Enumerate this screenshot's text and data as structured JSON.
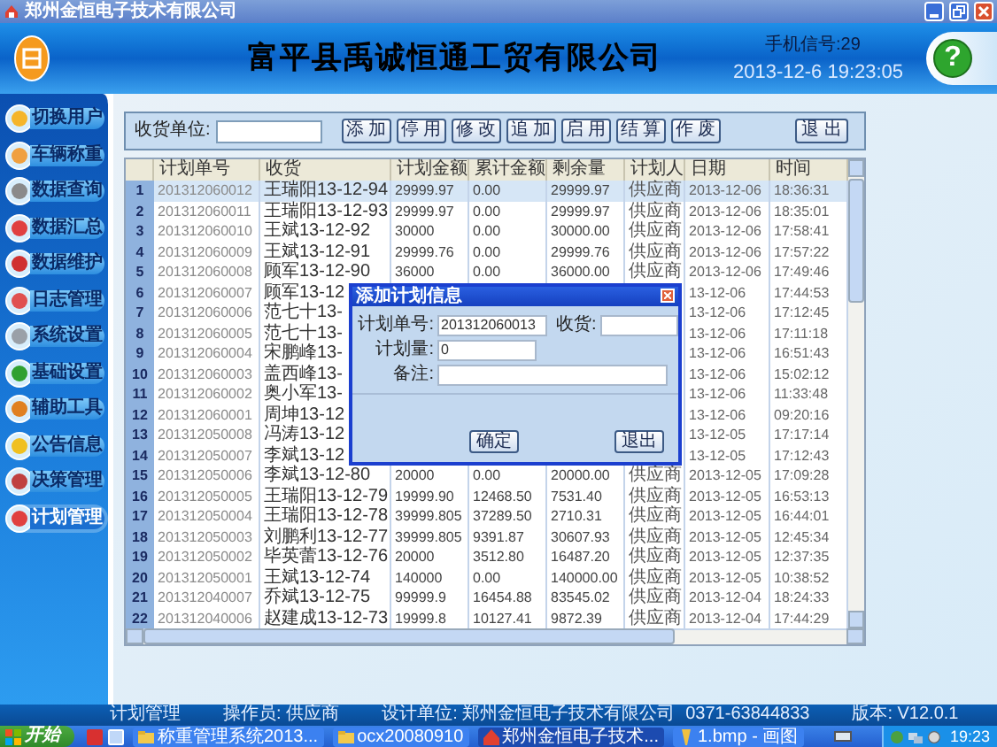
{
  "window": {
    "title": "郑州金恒电子技术有限公司"
  },
  "header": {
    "company": "富平县禹诚恒通工贸有限公司",
    "signal": "手机信号:29",
    "datetime": "2013-12-6 19:23:05",
    "help": "?"
  },
  "sidebar": {
    "items": [
      {
        "label": "切换用户",
        "selected": false
      },
      {
        "label": "车辆称重",
        "selected": false
      },
      {
        "label": "数据查询",
        "selected": false
      },
      {
        "label": "数据汇总",
        "selected": false
      },
      {
        "label": "数据维护",
        "selected": false
      },
      {
        "label": "日志管理",
        "selected": false
      },
      {
        "label": "系统设置",
        "selected": false
      },
      {
        "label": "基础设置",
        "selected": false
      },
      {
        "label": "辅助工具",
        "selected": false
      },
      {
        "label": "公告信息",
        "selected": false
      },
      {
        "label": "决策管理",
        "selected": false
      },
      {
        "label": "计划管理",
        "selected": true
      }
    ]
  },
  "toolbar": {
    "field_label": "收货单位:",
    "buttons": [
      "添 加",
      "停 用",
      "修 改",
      "追 加",
      "启 用",
      "结 算",
      "作 废"
    ],
    "exit": "退 出"
  },
  "table": {
    "columns": [
      "计划单号",
      "收货",
      "计划金额",
      "累计金额",
      "剩余量",
      "计划人",
      "日期",
      "时间"
    ],
    "rows": [
      {
        "no": "1",
        "selected": true,
        "cells": [
          "201312060012",
          "王瑞阳13-12-94",
          "29999.97",
          "0.00",
          "29999.97",
          "供应商",
          "2013-12-06",
          "18:36:31"
        ]
      },
      {
        "no": "2",
        "selected": false,
        "cells": [
          "201312060011",
          "王瑞阳13-12-93",
          "29999.97",
          "0.00",
          "29999.97",
          "供应商",
          "2013-12-06",
          "18:35:01"
        ]
      },
      {
        "no": "3",
        "selected": false,
        "cells": [
          "201312060010",
          "王斌13-12-92",
          "30000",
          "0.00",
          "30000.00",
          "供应商",
          "2013-12-06",
          "17:58:41"
        ]
      },
      {
        "no": "4",
        "selected": false,
        "cells": [
          "201312060009",
          "王斌13-12-91",
          "29999.76",
          "0.00",
          "29999.76",
          "供应商",
          "2013-12-06",
          "17:57:22"
        ]
      },
      {
        "no": "5",
        "selected": false,
        "cells": [
          "201312060008",
          "顾军13-12-90",
          "36000",
          "0.00",
          "36000.00",
          "供应商",
          "2013-12-06",
          "17:49:46"
        ]
      },
      {
        "no": "6",
        "selected": false,
        "cells": [
          "201312060007",
          "顾军13-12",
          null,
          null,
          null,
          null,
          "13-12-06",
          "17:44:53"
        ]
      },
      {
        "no": "7",
        "selected": false,
        "cells": [
          "201312060006",
          "范七十13-",
          null,
          null,
          null,
          null,
          "13-12-06",
          "17:12:45"
        ]
      },
      {
        "no": "8",
        "selected": false,
        "cells": [
          "201312060005",
          "范七十13-",
          null,
          null,
          null,
          null,
          "13-12-06",
          "17:11:18"
        ]
      },
      {
        "no": "9",
        "selected": false,
        "cells": [
          "201312060004",
          "宋鹏峰13-",
          null,
          null,
          null,
          null,
          "13-12-06",
          "16:51:43"
        ]
      },
      {
        "no": "10",
        "selected": false,
        "cells": [
          "201312060003",
          "盖西峰13-",
          null,
          null,
          null,
          null,
          "13-12-06",
          "15:02:12"
        ]
      },
      {
        "no": "11",
        "selected": false,
        "cells": [
          "201312060002",
          "奥小军13-",
          null,
          null,
          null,
          null,
          "13-12-06",
          "11:33:48"
        ]
      },
      {
        "no": "12",
        "selected": false,
        "cells": [
          "201312060001",
          "周坤13-12",
          null,
          null,
          null,
          null,
          "13-12-06",
          "09:20:16"
        ]
      },
      {
        "no": "13",
        "selected": false,
        "cells": [
          "201312050008",
          "冯涛13-12",
          null,
          null,
          null,
          null,
          "13-12-05",
          "17:17:14"
        ]
      },
      {
        "no": "14",
        "selected": false,
        "cells": [
          "201312050007",
          "李斌13-12",
          null,
          null,
          null,
          null,
          "13-12-05",
          "17:12:43"
        ]
      },
      {
        "no": "15",
        "selected": false,
        "cells": [
          "201312050006",
          "李斌13-12-80",
          "20000",
          "0.00",
          "20000.00",
          "供应商",
          "2013-12-05",
          "17:09:28"
        ]
      },
      {
        "no": "16",
        "selected": false,
        "cells": [
          "201312050005",
          "王瑞阳13-12-79",
          "19999.90",
          "12468.50",
          "7531.40",
          "供应商",
          "2013-12-05",
          "16:53:13"
        ]
      },
      {
        "no": "17",
        "selected": false,
        "cells": [
          "201312050004",
          "王瑞阳13-12-78",
          "39999.805",
          "37289.50",
          "2710.31",
          "供应商",
          "2013-12-05",
          "16:44:01"
        ]
      },
      {
        "no": "18",
        "selected": false,
        "cells": [
          "201312050003",
          "刘鹏利13-12-77",
          "39999.805",
          "9391.87",
          "30607.93",
          "供应商",
          "2013-12-05",
          "12:45:34"
        ]
      },
      {
        "no": "19",
        "selected": false,
        "cells": [
          "201312050002",
          "毕英蕾13-12-76",
          "20000",
          "3512.80",
          "16487.20",
          "供应商",
          "2013-12-05",
          "12:37:35"
        ]
      },
      {
        "no": "20",
        "selected": false,
        "cells": [
          "201312050001",
          "王斌13-12-74",
          "140000",
          "0.00",
          "140000.00",
          "供应商",
          "2013-12-05",
          "10:38:52"
        ]
      },
      {
        "no": "21",
        "selected": false,
        "cells": [
          "201312040007",
          "乔斌13-12-75",
          "99999.9",
          "16454.88",
          "83545.02",
          "供应商",
          "2013-12-04",
          "18:24:33"
        ]
      },
      {
        "no": "22",
        "selected": false,
        "cells": [
          "201312040006",
          "赵建成13-12-73",
          "19999.8",
          "10127.41",
          "9872.39",
          "供应商",
          "2013-12-04",
          "17:44:29"
        ]
      }
    ]
  },
  "dialog": {
    "title": "添加计划信息",
    "fields": [
      {
        "label": "计划单号:",
        "value": "201312060013"
      },
      {
        "label": "收货:"
      },
      {
        "label": "计划量:",
        "value": "0"
      },
      {
        "label": "备注:"
      }
    ],
    "buttons": [
      "确定",
      "退出"
    ]
  },
  "status_bar": [
    "计划管理",
    "操作员: 供应商",
    "设计单位: 郑州金恒电子技术有限公司",
    "0371-63844833",
    "版本: V12.0.1"
  ],
  "taskbar": {
    "start": "开始",
    "tasks": [
      {
        "label": "称重管理系统2013...",
        "selected": false
      },
      {
        "label": "ocx20080910",
        "selected": false
      },
      {
        "label": "郑州金恒电子技术...",
        "selected": true
      },
      {
        "label": "1.bmp - 画图",
        "selected": false
      }
    ],
    "clock": "19:23"
  }
}
